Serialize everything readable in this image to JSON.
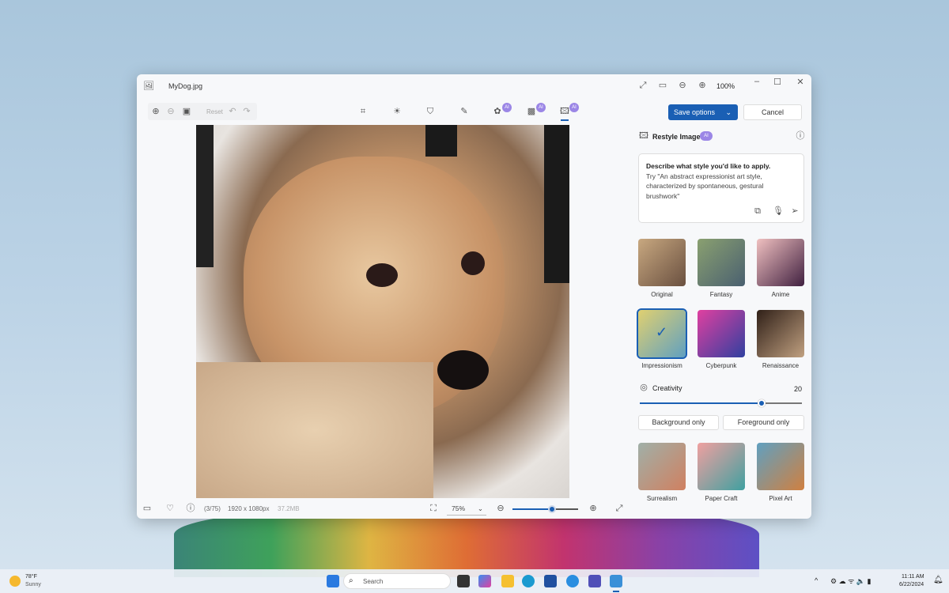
{
  "window": {
    "title": "MyDog.jpg",
    "zoom": "100%"
  },
  "toolbar": {
    "reset": "Reset",
    "ai_badge": "AI"
  },
  "header": {
    "save": "Save options",
    "cancel": "Cancel"
  },
  "panel": {
    "title": "Restyle Image",
    "ai_badge": "AI",
    "prompt_title": "Describe what style you'd like to apply.",
    "prompt_hint": "Try \"An abstract expressionist art style, characterized by spontaneous, gestural brushwork\"",
    "styles": [
      {
        "label": "Original",
        "colors": [
          "#c8a880",
          "#6a5040"
        ]
      },
      {
        "label": "Fantasy",
        "colors": [
          "#8aa070",
          "#4a6070"
        ]
      },
      {
        "label": "Anime",
        "colors": [
          "#f0c0c0",
          "#402040"
        ]
      },
      {
        "label": "Impressionism",
        "colors": [
          "#e0d070",
          "#60a0c0"
        ],
        "selected": true
      },
      {
        "label": "Cyberpunk",
        "colors": [
          "#e040a0",
          "#3040a0"
        ]
      },
      {
        "label": "Renaissance",
        "colors": [
          "#302018",
          "#c0a080"
        ]
      }
    ],
    "creativity_label": "Creativity",
    "creativity_value": "20",
    "creativity_fraction": 0.75,
    "background_only": "Background only",
    "foreground_only": "Foreground only",
    "more_styles": [
      {
        "label": "Surrealism",
        "colors": [
          "#a0b0a8",
          "#d08060"
        ]
      },
      {
        "label": "Paper Craft",
        "colors": [
          "#f0a0a0",
          "#40a0a0"
        ]
      },
      {
        "label": "Pixel Art",
        "colors": [
          "#60a0c0",
          "#d08040"
        ]
      }
    ]
  },
  "statusbar": {
    "index": "(3/75)",
    "dimensions": "1920 x 1080px",
    "size": "37.2MB",
    "zoom": "75%",
    "zoom_fraction": 0.6
  },
  "taskbar": {
    "temp": "78°F",
    "weather": "Sunny",
    "search": "Search",
    "time": "11:11 AM",
    "date": "6/22/2024"
  }
}
